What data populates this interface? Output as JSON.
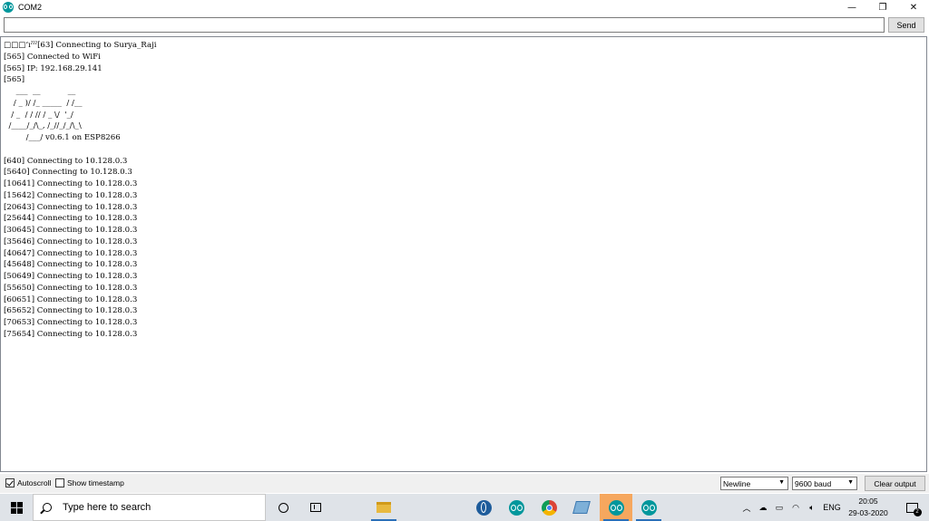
{
  "window": {
    "title": "COM2",
    "minimize_glyph": "—",
    "restore_glyph": "❐",
    "close_glyph": "✕"
  },
  "input": {
    "value": "",
    "send_label": "Send"
  },
  "output_lines": [
    "□□□‘ıˀˀˀ[63] Connecting to Surya_Raji",
    "[565] Connected to WiFi",
    "[565] IP: 192.168.29.141",
    "[565]",
    "     ___  __           __",
    "    / _ )/ /_ _____  / /__",
    "   / _  / / // / _ \\/  '_/",
    "  /____/_/\\_, /_//_/_/\\_\\",
    "         /___/ v0.6.1 on ESP8266",
    "",
    "[640] Connecting to 10.128.0.3",
    "[5640] Connecting to 10.128.0.3",
    "[10641] Connecting to 10.128.0.3",
    "[15642] Connecting to 10.128.0.3",
    "[20643] Connecting to 10.128.0.3",
    "[25644] Connecting to 10.128.0.3",
    "[30645] Connecting to 10.128.0.3",
    "[35646] Connecting to 10.128.0.3",
    "[40647] Connecting to 10.128.0.3",
    "[45648] Connecting to 10.128.0.3",
    "[50649] Connecting to 10.128.0.3",
    "[55650] Connecting to 10.128.0.3",
    "[60651] Connecting to 10.128.0.3",
    "[65652] Connecting to 10.128.0.3",
    "[70653] Connecting to 10.128.0.3",
    "[75654] Connecting to 10.128.0.3"
  ],
  "bottom": {
    "autoscroll_label": "Autoscroll",
    "autoscroll_checked": true,
    "timestamp_label": "Show timestamp",
    "timestamp_checked": false,
    "line_ending": "Newline",
    "baud": "9600 baud",
    "clear_label": "Clear output"
  },
  "taskbar": {
    "search_placeholder": "Type here to search",
    "tray_language": "ENG",
    "clock_time": "20:05",
    "clock_date": "29-03-2020",
    "notification_count": "2"
  },
  "colors": {
    "arduino_teal": "#00979c",
    "active_task_bg": "#f6a75e",
    "taskbar_bg": "#dfe3e8",
    "bottombar_bg": "#f0f0f0"
  }
}
